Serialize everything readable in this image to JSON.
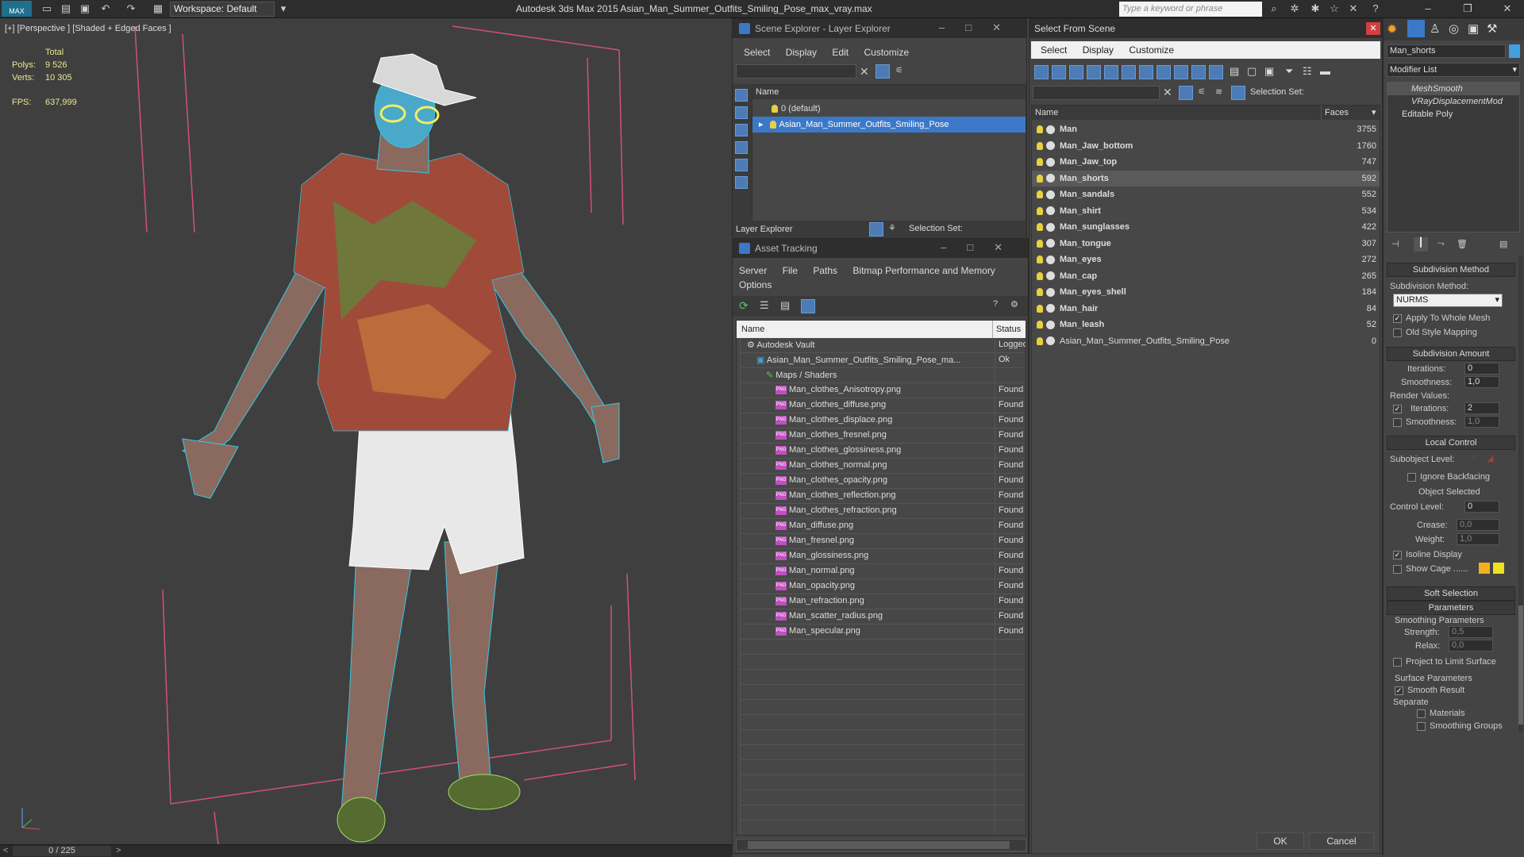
{
  "titlebar": {
    "workspace": "Workspace: Default",
    "app_title": "Autodesk 3ds Max  2015      Asian_Man_Summer_Outfits_Smiling_Pose_max_vray.max",
    "search_placeholder": "Type a keyword or phrase",
    "max_label": "MAX"
  },
  "viewport": {
    "label": "[+] [Perspective ] [Shaded + Edged Faces ]",
    "stats": {
      "total_label": "Total",
      "polys_label": "Polys:",
      "polys_value": "9 526",
      "verts_label": "Verts:",
      "verts_value": "10 305",
      "fps_label": "FPS:",
      "fps_value": "637,999"
    }
  },
  "timeline": {
    "frame": "0 / 225",
    "prev": "<",
    "next": ">"
  },
  "scene_explorer": {
    "title": "Scene Explorer - Layer Explorer",
    "menus": [
      "Select",
      "Display",
      "Edit",
      "Customize"
    ],
    "col_name": "Name",
    "layers": [
      "0 (default)",
      "Asian_Man_Summer_Outfits_Smiling_Pose"
    ],
    "footer_label": "Layer Explorer",
    "selection_set": "Selection Set:"
  },
  "asset_tracking": {
    "title": "Asset Tracking",
    "menus": [
      "Server",
      "File",
      "Paths",
      "Bitmap Performance and Memory"
    ],
    "options": "Options",
    "col_name": "Name",
    "col_status": "Status",
    "rows": [
      {
        "name": "Autodesk Vault",
        "status": "Logged",
        "indent": 0
      },
      {
        "name": "Asian_Man_Summer_Outfits_Smiling_Pose_ma...",
        "status": "Ok",
        "indent": 1
      },
      {
        "name": "Maps / Shaders",
        "status": "",
        "indent": 2
      },
      {
        "name": "Man_clothes_Anisotropy.png",
        "status": "Found",
        "indent": 3
      },
      {
        "name": "Man_clothes_diffuse.png",
        "status": "Found",
        "indent": 3
      },
      {
        "name": "Man_clothes_displace.png",
        "status": "Found",
        "indent": 3
      },
      {
        "name": "Man_clothes_fresnel.png",
        "status": "Found",
        "indent": 3
      },
      {
        "name": "Man_clothes_glossiness.png",
        "status": "Found",
        "indent": 3
      },
      {
        "name": "Man_clothes_normal.png",
        "status": "Found",
        "indent": 3
      },
      {
        "name": "Man_clothes_opacity.png",
        "status": "Found",
        "indent": 3
      },
      {
        "name": "Man_clothes_reflection.png",
        "status": "Found",
        "indent": 3
      },
      {
        "name": "Man_clothes_refraction.png",
        "status": "Found",
        "indent": 3
      },
      {
        "name": "Man_diffuse.png",
        "status": "Found",
        "indent": 3
      },
      {
        "name": "Man_fresnel.png",
        "status": "Found",
        "indent": 3
      },
      {
        "name": "Man_glossiness.png",
        "status": "Found",
        "indent": 3
      },
      {
        "name": "Man_normal.png",
        "status": "Found",
        "indent": 3
      },
      {
        "name": "Man_opacity.png",
        "status": "Found",
        "indent": 3
      },
      {
        "name": "Man_refraction.png",
        "status": "Found",
        "indent": 3
      },
      {
        "name": "Man_scatter_radius.png",
        "status": "Found",
        "indent": 3
      },
      {
        "name": "Man_specular.png",
        "status": "Found",
        "indent": 3
      }
    ]
  },
  "select_from_scene": {
    "title": "Select From Scene",
    "menus": [
      "Select",
      "Display",
      "Customize"
    ],
    "selection_set": "Selection Set:",
    "col_name": "Name",
    "col_faces": "Faces",
    "rows": [
      {
        "name": "Man",
        "faces": "3755"
      },
      {
        "name": "Man_Jaw_bottom",
        "faces": "1760"
      },
      {
        "name": "Man_Jaw_top",
        "faces": "747"
      },
      {
        "name": "Man_shorts",
        "faces": "592",
        "selected": true
      },
      {
        "name": "Man_sandals",
        "faces": "552"
      },
      {
        "name": "Man_shirt",
        "faces": "534"
      },
      {
        "name": "Man_sunglasses",
        "faces": "422"
      },
      {
        "name": "Man_tongue",
        "faces": "307"
      },
      {
        "name": "Man_eyes",
        "faces": "272"
      },
      {
        "name": "Man_cap",
        "faces": "265"
      },
      {
        "name": "Man_eyes_shell",
        "faces": "184"
      },
      {
        "name": "Man_hair",
        "faces": "84"
      },
      {
        "name": "Man_leash",
        "faces": "52"
      },
      {
        "name": "Asian_Man_Summer_Outfits_Smiling_Pose",
        "faces": "0",
        "group": true
      }
    ],
    "ok": "OK",
    "cancel": "Cancel"
  },
  "modify_panel": {
    "object_name": "Man_shorts",
    "modifier_list": "Modifier List",
    "stack": [
      "MeshSmooth",
      "VRayDisplacementMod",
      "Editable Poly"
    ],
    "subdivision_method": {
      "header": "Subdivision Method",
      "label": "Subdivision Method:",
      "value": "NURMS",
      "apply_whole": "Apply To Whole Mesh",
      "old_style": "Old Style Mapping"
    },
    "subdivision_amount": {
      "header": "Subdivision Amount",
      "iterations_label": "Iterations:",
      "iterations": "0",
      "smoothness_label": "Smoothness:",
      "smoothness": "1,0",
      "render_values": "Render Values:",
      "r_iterations": "2",
      "r_smoothness": "1,0"
    },
    "local_control": {
      "header": "Local Control",
      "subobject": "Subobject Level:",
      "ignore_backfacing": "Ignore Backfacing",
      "object_selected": "Object Selected",
      "control_level_label": "Control Level:",
      "control_level": "0",
      "crease_label": "Crease:",
      "crease": "0,0",
      "weight_label": "Weight:",
      "weight": "1,0",
      "isoline": "Isoline Display",
      "show_cage": "Show Cage ......"
    },
    "soft_selection": {
      "header": "Soft Selection"
    },
    "parameters": {
      "header": "Parameters",
      "smoothing": "Smoothing Parameters",
      "strength_label": "Strength:",
      "strength": "0,5",
      "relax_label": "Relax:",
      "relax": "0,0",
      "project": "Project to Limit Surface",
      "surface": "Surface Parameters",
      "smooth_result": "Smooth Result",
      "separate": "Separate",
      "materials": "Materials",
      "smoothing_groups": "Smoothing Groups"
    }
  },
  "colors": {
    "accent": "#3c78c8",
    "selected_row": "#5a5a5a",
    "found": "#dddddd",
    "wire": "#36c8e8",
    "box": "#d0507a",
    "stat": "#e8e890"
  }
}
